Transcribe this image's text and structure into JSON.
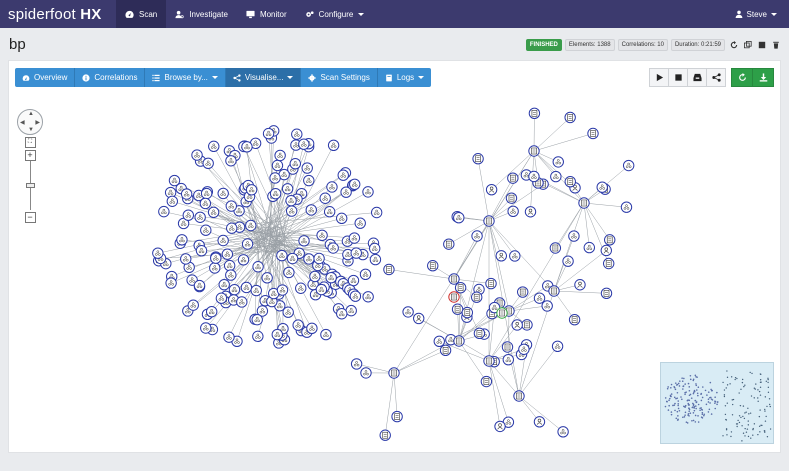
{
  "topbar": {
    "brand_a": "spiderfoot",
    "brand_b": "HX",
    "nav": [
      {
        "label": "Scan",
        "icon": "gauge-icon"
      },
      {
        "label": "Investigate",
        "icon": "user-search-icon"
      },
      {
        "label": "Monitor",
        "icon": "monitor-icon"
      },
      {
        "label": "Configure",
        "icon": "gears-icon"
      }
    ],
    "user": "Steve"
  },
  "scan": {
    "title": "bp",
    "status": "FINISHED",
    "elements": "Elements: 1388",
    "correlations": "Correlations: 10",
    "duration": "Duration: 0:21:59"
  },
  "tabs": [
    {
      "label": "Overview",
      "icon": "dashboard-icon"
    },
    {
      "label": "Correlations",
      "icon": "info-icon"
    },
    {
      "label": "Browse by...",
      "icon": "list-icon"
    },
    {
      "label": "Visualise...",
      "icon": "share-icon"
    },
    {
      "label": "Scan Settings",
      "icon": "gear-icon"
    },
    {
      "label": "Logs",
      "icon": "book-icon"
    }
  ],
  "colors": {
    "topbar": "#3c3a6e",
    "tab_blue": "#3a8fd3",
    "finished": "#3a9c4b",
    "node_stroke": "#2b3aa8",
    "edge": "#9aa0a6",
    "red_node": "#d0312d",
    "green_node": "#3aa845"
  }
}
